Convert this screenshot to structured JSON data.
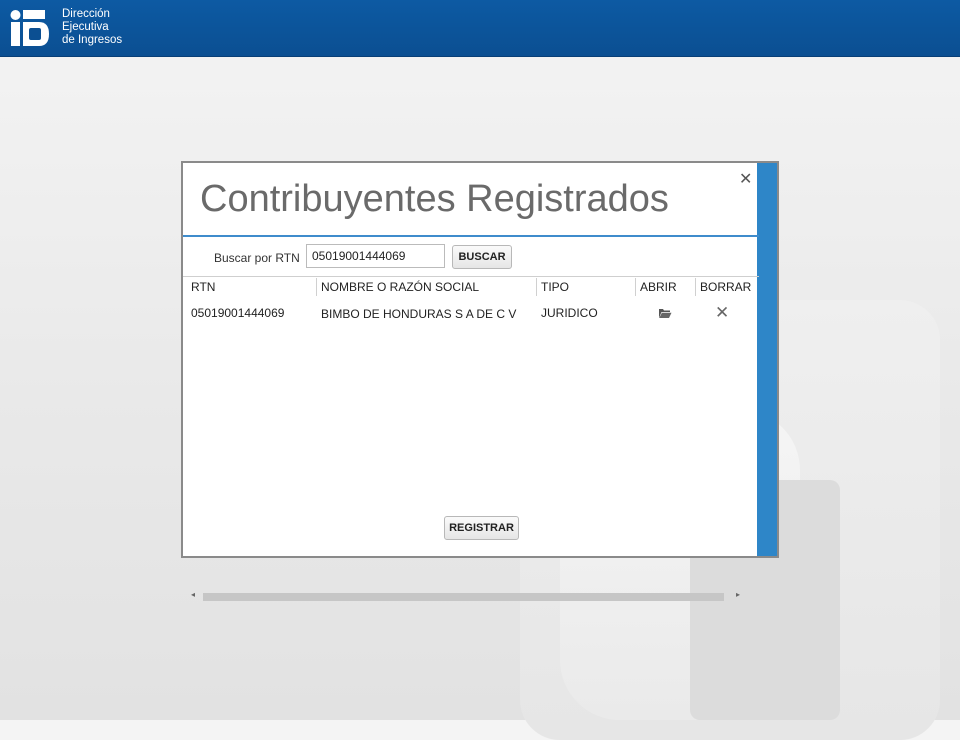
{
  "header": {
    "org_line1": "Dirección",
    "org_line2": "Ejecutiva",
    "org_line3": "de Ingresos"
  },
  "dialog": {
    "title": "Contribuyentes Registrados",
    "close_label": "✕",
    "search": {
      "label": "Buscar por RTN",
      "value": "05019001444069",
      "button_label": "BUSCAR"
    },
    "table": {
      "columns": [
        "RTN",
        "NOMBRE O RAZÓN SOCIAL",
        "TIPO",
        "ABRIR",
        "BORRAR"
      ],
      "rows": [
        {
          "rtn": "05019001444069",
          "nombre": "BIMBO DE HONDURAS S A DE C V",
          "tipo": "JURIDICO",
          "abrir_icon": "folder-open-icon",
          "borrar_icon": "close-icon"
        }
      ]
    },
    "register_label": "REGISTRAR"
  },
  "colors": {
    "header_blue": "#0b4f92",
    "accent_blue": "#2e86c8",
    "title_gray": "#6a6a6a"
  }
}
